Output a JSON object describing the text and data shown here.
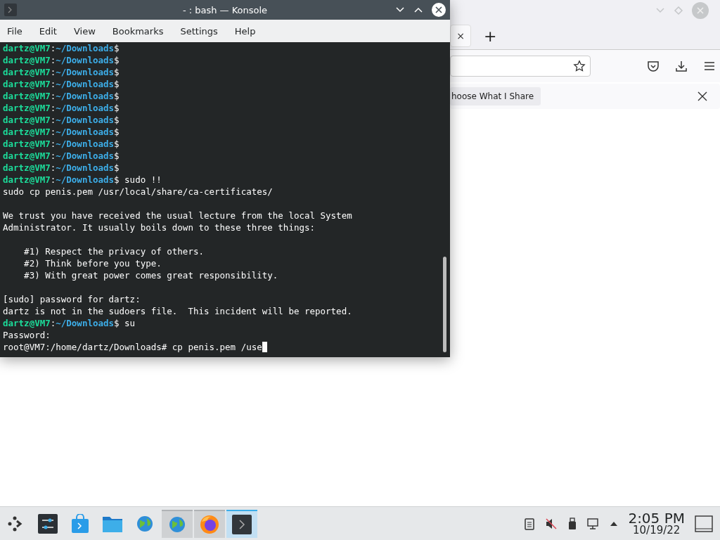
{
  "browser": {
    "tab_close": "×",
    "new_tab": "+",
    "notification": {
      "button": "hoose What I Share"
    }
  },
  "terminal": {
    "title": "- : bash — Konsole",
    "menu": [
      "File",
      "Edit",
      "View",
      "Bookmarks",
      "Settings",
      "Help"
    ],
    "lines": [
      {
        "kind": "prompt",
        "user": "dartz@VM7",
        "sep": ":",
        "path": "~/Downloads",
        "sign": "$"
      },
      {
        "kind": "prompt",
        "user": "dartz@VM7",
        "sep": ":",
        "path": "~/Downloads",
        "sign": "$"
      },
      {
        "kind": "prompt",
        "user": "dartz@VM7",
        "sep": ":",
        "path": "~/Downloads",
        "sign": "$"
      },
      {
        "kind": "prompt",
        "user": "dartz@VM7",
        "sep": ":",
        "path": "~/Downloads",
        "sign": "$"
      },
      {
        "kind": "prompt",
        "user": "dartz@VM7",
        "sep": ":",
        "path": "~/Downloads",
        "sign": "$"
      },
      {
        "kind": "prompt",
        "user": "dartz@VM7",
        "sep": ":",
        "path": "~/Downloads",
        "sign": "$"
      },
      {
        "kind": "prompt",
        "user": "dartz@VM7",
        "sep": ":",
        "path": "~/Downloads",
        "sign": "$"
      },
      {
        "kind": "prompt",
        "user": "dartz@VM7",
        "sep": ":",
        "path": "~/Downloads",
        "sign": "$"
      },
      {
        "kind": "prompt",
        "user": "dartz@VM7",
        "sep": ":",
        "path": "~/Downloads",
        "sign": "$"
      },
      {
        "kind": "prompt",
        "user": "dartz@VM7",
        "sep": ":",
        "path": "~/Downloads",
        "sign": "$"
      },
      {
        "kind": "prompt",
        "user": "dartz@VM7",
        "sep": ":",
        "path": "~/Downloads",
        "sign": "$"
      },
      {
        "kind": "prompt",
        "user": "dartz@VM7",
        "sep": ":",
        "path": "~/Downloads",
        "sign": "$",
        "command": "sudo !!"
      },
      {
        "kind": "output",
        "text": "sudo cp penis.pem /usr/local/share/ca-certificates/"
      },
      {
        "kind": "blank"
      },
      {
        "kind": "output",
        "text": "We trust you have received the usual lecture from the local System"
      },
      {
        "kind": "output",
        "text": "Administrator. It usually boils down to these three things:"
      },
      {
        "kind": "blank"
      },
      {
        "kind": "output",
        "text": "    #1) Respect the privacy of others."
      },
      {
        "kind": "output",
        "text": "    #2) Think before you type."
      },
      {
        "kind": "output",
        "text": "    #3) With great power comes great responsibility."
      },
      {
        "kind": "blank"
      },
      {
        "kind": "output",
        "text": "[sudo] password for dartz:"
      },
      {
        "kind": "output",
        "text": "dartz is not in the sudoers file.  This incident will be reported."
      },
      {
        "kind": "prompt",
        "user": "dartz@VM7",
        "sep": ":",
        "path": "~/Downloads",
        "sign": "$",
        "command": "su"
      },
      {
        "kind": "output",
        "text": "Password:"
      },
      {
        "kind": "output",
        "text": "root@VM7:/home/dartz/Downloads# cp penis.pem /use",
        "cursor": true
      }
    ]
  },
  "taskbar": {
    "items": [
      {
        "kind": "launcher",
        "active": false
      },
      {
        "kind": "settings",
        "active": false
      },
      {
        "kind": "store",
        "active": false
      },
      {
        "kind": "folder",
        "active": false
      },
      {
        "kind": "globe",
        "active": false
      },
      {
        "kind": "globe",
        "active": true
      },
      {
        "kind": "firefox",
        "active": true
      },
      {
        "kind": "terminal",
        "active": true
      }
    ],
    "time": "2:05 PM",
    "date": "10/19/22"
  }
}
